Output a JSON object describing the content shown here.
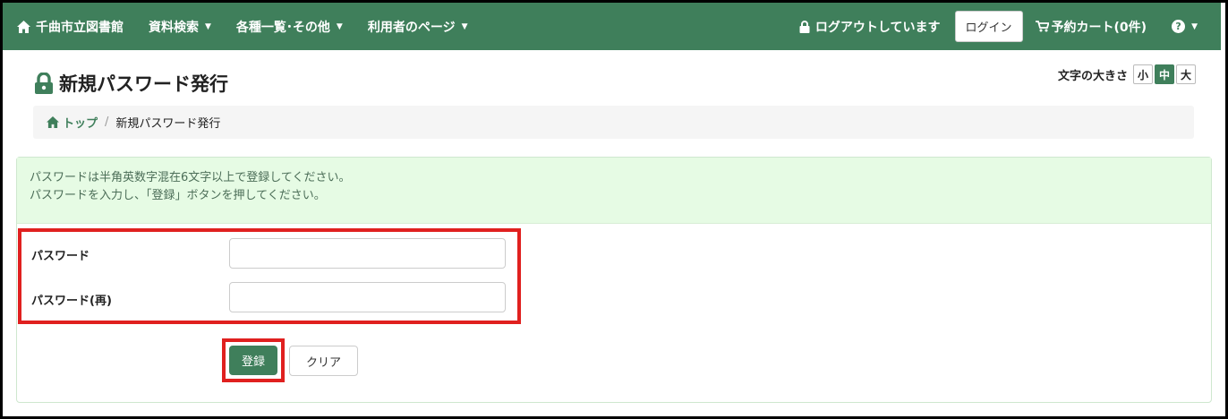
{
  "navbar": {
    "brand": "千曲市立図書館",
    "menus": [
      {
        "label": "資料検索"
      },
      {
        "label": "各種一覧･その他"
      },
      {
        "label": "利用者のページ"
      }
    ],
    "login_status": "ログアウトしています",
    "login_button": "ログイン",
    "cart": "予約カート(0件)",
    "help": "?"
  },
  "header": {
    "title": "新規パスワード発行",
    "font_size_label": "文字の大きさ",
    "font_sizes": [
      "小",
      "中",
      "大"
    ],
    "font_size_selected": "中"
  },
  "breadcrumb": {
    "top": "トップ",
    "separator": "/",
    "current": "新規パスワード発行"
  },
  "notice": {
    "line1": "パスワードは半角英数字混在6文字以上で登録してください。",
    "line2": "パスワードを入力し、「登録」ボタンを押してください。"
  },
  "form": {
    "password_label": "パスワード",
    "password_value": "",
    "password_confirm_label": "パスワード(再)",
    "password_confirm_value": "",
    "submit_label": "登録",
    "clear_label": "クリア"
  },
  "colors": {
    "brand_green": "#3f7f5b",
    "alert_bg": "#e6fbe4",
    "highlight_red": "#e0201f"
  }
}
